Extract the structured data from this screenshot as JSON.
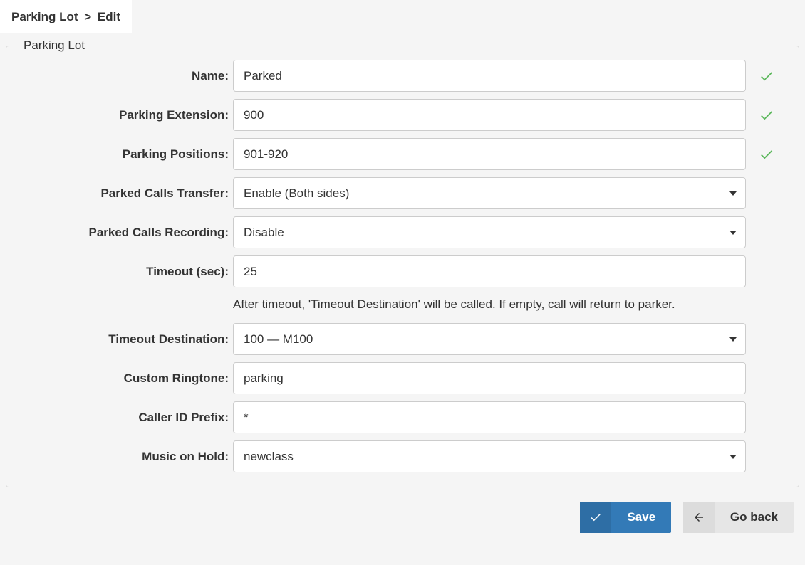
{
  "breadcrumb": {
    "root": "Parking Lot",
    "current": "Edit"
  },
  "legend": "Parking Lot",
  "fields": {
    "name": {
      "label": "Name:",
      "value": "Parked",
      "valid": true
    },
    "extension": {
      "label": "Parking Extension:",
      "value": "900",
      "valid": true
    },
    "positions": {
      "label": "Parking Positions:",
      "value": "901-920",
      "valid": true
    },
    "transfer": {
      "label": "Parked Calls Transfer:",
      "value": "Enable (Both sides)"
    },
    "recording": {
      "label": "Parked Calls Recording:",
      "value": "Disable"
    },
    "timeout": {
      "label": "Timeout (sec):",
      "value": "25"
    },
    "timeout_help": "After timeout, 'Timeout Destination' will be called. If empty, call will return to parker.",
    "timeout_dest": {
      "label": "Timeout Destination:",
      "value": "100 — M100"
    },
    "ringtone": {
      "label": "Custom Ringtone:",
      "value": "parking"
    },
    "cid_prefix": {
      "label": "Caller ID Prefix:",
      "value": "*"
    },
    "moh": {
      "label": "Music on Hold:",
      "value": "newclass"
    }
  },
  "buttons": {
    "save": "Save",
    "back": "Go back"
  }
}
